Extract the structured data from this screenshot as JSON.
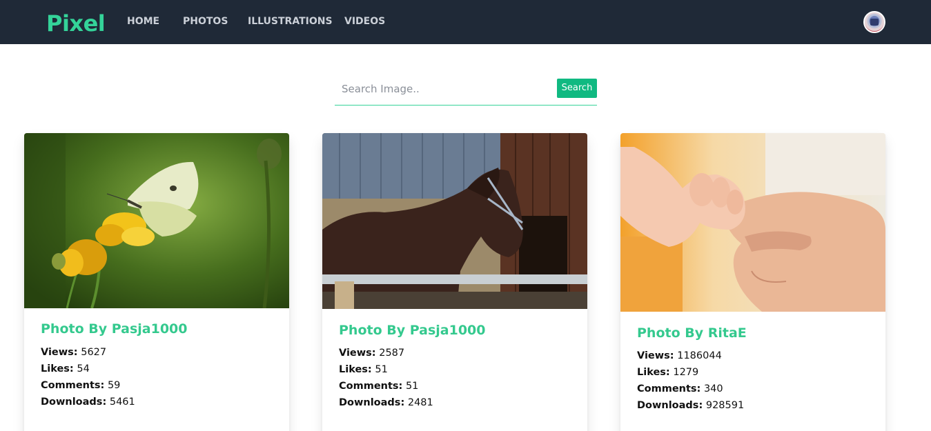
{
  "brand": {
    "logo_text": "Pixel",
    "accent_color": "#34d399",
    "navbar_color": "#1f2937"
  },
  "nav": {
    "items": [
      {
        "label": "HOME"
      },
      {
        "label": "PHOTOS"
      },
      {
        "label": "ILLUSTRATIONS"
      },
      {
        "label": "VIDEOS"
      }
    ]
  },
  "user": {
    "avatar_icon": "user-avatar-icon"
  },
  "search": {
    "placeholder": "Search Image..",
    "value": "",
    "button_label": "Search"
  },
  "stat_labels": {
    "views": "Views:",
    "likes": "Likes:",
    "comments": "Comments:",
    "downloads": "Downloads:"
  },
  "cards": [
    {
      "title": "Photo By Pasja1000",
      "image": "butterfly-on-yellow-flower",
      "views": "5627",
      "likes": "54",
      "comments": "59",
      "downloads": "5461"
    },
    {
      "title": "Photo By Pasja1000",
      "image": "horse-at-stable",
      "views": "2587",
      "likes": "51",
      "comments": "51",
      "downloads": "2481"
    },
    {
      "title": "Photo By RitaE",
      "image": "baby-hand-holding-finger",
      "views": "1186044",
      "likes": "1279",
      "comments": "340",
      "downloads": "928591"
    }
  ]
}
